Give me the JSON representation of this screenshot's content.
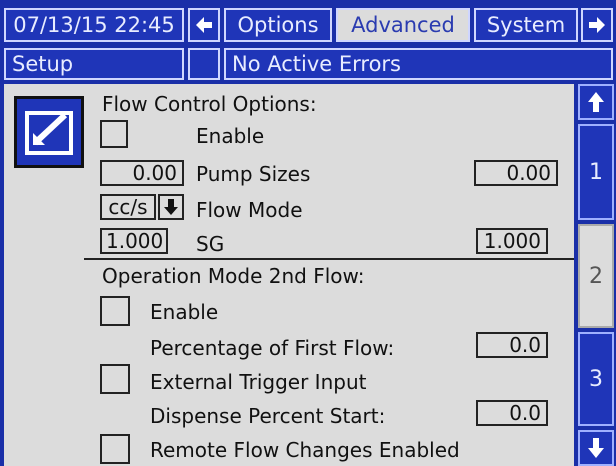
{
  "header": {
    "datetime": "07/13/15 22:45",
    "tabs": [
      {
        "label": "Options"
      },
      {
        "label": "Advanced"
      },
      {
        "label": "System"
      }
    ]
  },
  "status": {
    "screen": "Setup",
    "errors": "No Active Errors"
  },
  "flow_control": {
    "title": "Flow Control Options:",
    "enable_label": "Enable",
    "pump_sizes_label": "Pump Sizes",
    "pump_size_left": "0.00",
    "pump_size_right": "0.00",
    "flow_mode_value": "cc/s",
    "flow_mode_label": "Flow Mode",
    "sg_left": "1.000",
    "sg_label": "SG",
    "sg_right": "1.000"
  },
  "operation_mode": {
    "title": "Operation Mode 2nd Flow:",
    "enable_label": "Enable",
    "percent_first_label": "Percentage of First Flow:",
    "percent_first_value": "0.0",
    "external_trigger_label": "External Trigger Input",
    "dispense_percent_label": "Dispense Percent Start:",
    "dispense_percent_value": "0.0",
    "remote_flow_label": "Remote Flow Changes Enabled"
  },
  "pages": [
    "1",
    "2",
    "3"
  ],
  "colors": {
    "screen_blue": "#1f35b8",
    "panel_gray": "#dcdcdc"
  }
}
